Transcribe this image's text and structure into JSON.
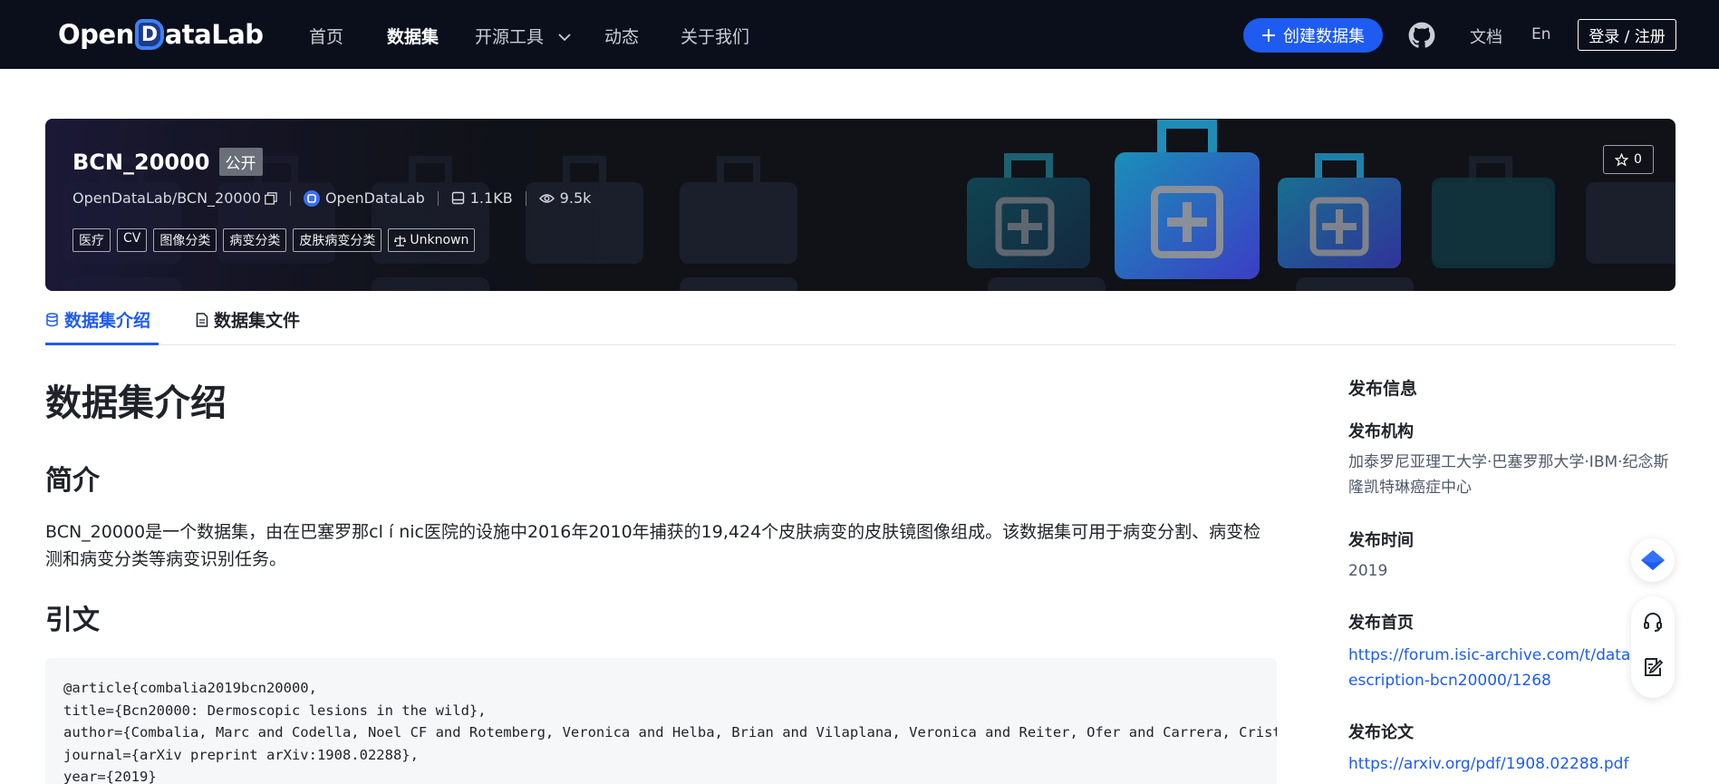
{
  "nav": {
    "logo_pre": "Open",
    "logo_d": "D",
    "logo_post": "ataLab",
    "items": [
      "首页",
      "数据集",
      "开源工具",
      "动态",
      "关于我们"
    ],
    "active_index": 1,
    "create_label": "创建数据集",
    "docs": "文档",
    "lang": "En",
    "login": "登录 / 注册"
  },
  "banner": {
    "name": "BCN_20000",
    "visibility": "公开",
    "path": "OpenDataLab/BCN_20000",
    "org": "OpenDataLab",
    "size": "1.1KB",
    "views": "9.5k",
    "tags": [
      "医疗",
      "CV",
      "图像分类",
      "病变分类",
      "皮肤病变分类"
    ],
    "license": "Unknown",
    "stars": "0"
  },
  "tabs": [
    "数据集介绍",
    "数据集文件"
  ],
  "content": {
    "title": "数据集介绍",
    "intro_heading": "简介",
    "intro_text": "BCN_20000是一个数据集，由在巴塞罗那cl í nic医院的设施中2016年2010年捕获的19,424个皮肤病变的皮肤镜图像组成。该数据集可用于病变分割、病变检测和病变分类等病变识别任务。",
    "citation_heading": "引文",
    "citation_lines": [
      "@article{combalia2019bcn20000,",
      "title={Bcn20000: Dermoscopic lesions in the wild},",
      "author={Combalia, Marc and Codella, Noel CF and Rotemberg, Veronica and Helba, Brian and Vilaplana, Veronica and Reiter, Ofer and Carrera, Cristina and Barreiro, Alicia},",
      "journal={arXiv preprint arXiv:1908.02288},",
      "year={2019}"
    ]
  },
  "sidebar": {
    "heading": "发布信息",
    "org_label": "发布机构",
    "org_value": "加泰罗尼亚理工大学·巴塞罗那大学·IBM·纪念斯隆凯特琳癌症中心",
    "time_label": "发布时间",
    "time_value": "2019",
    "home_label": "发布首页",
    "home_value": "https://forum.isic-archive.com/t/dataset-description-bcn20000/1268",
    "paper_label": "发布论文",
    "paper_value": "https://arxiv.org/pdf/1908.02288.pdf"
  },
  "colors": {
    "nav_bg": "#0b0f1c",
    "accent": "#1e5bf0",
    "banner_bg": "#101218"
  }
}
